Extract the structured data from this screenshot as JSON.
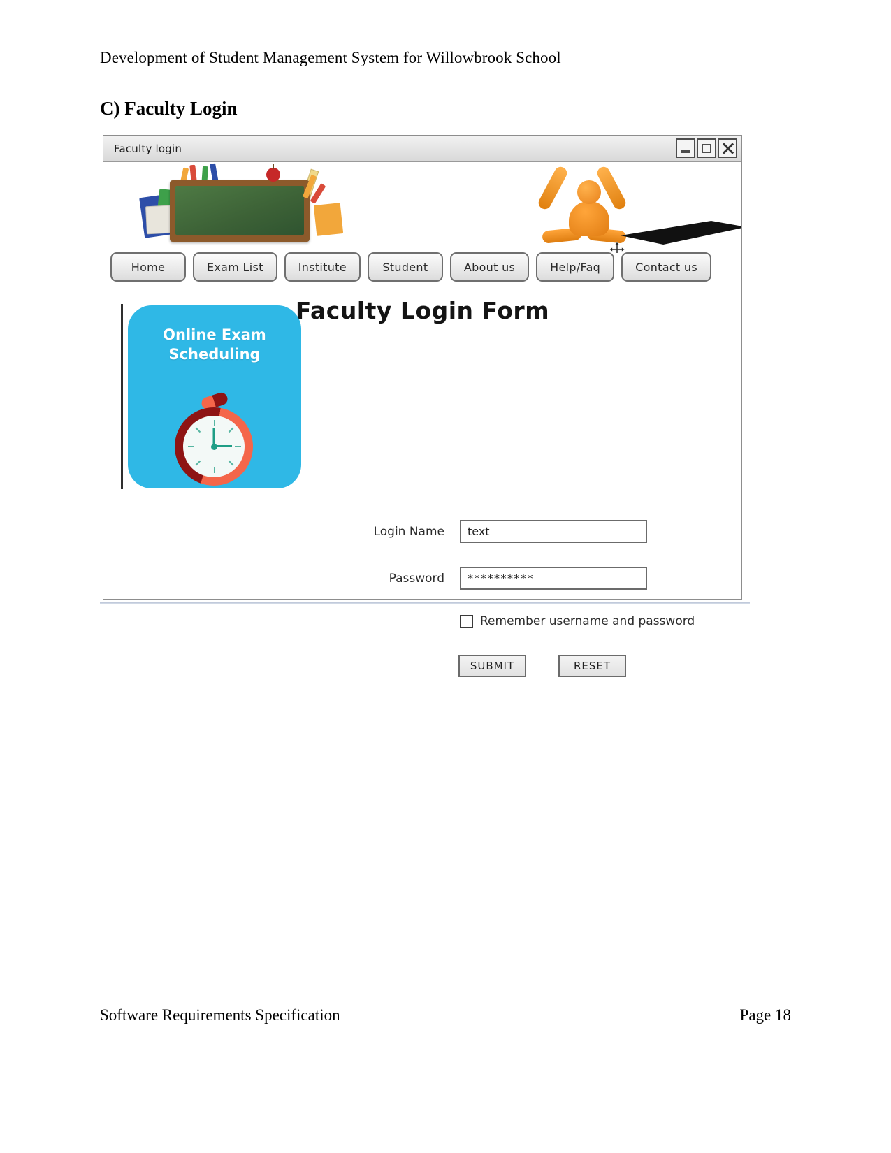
{
  "document": {
    "header": "Development of Student Management System for Willowbrook School",
    "section_title": "C) Faculty Login",
    "footer_left": "Software Requirements Specification",
    "footer_right": "Page 18"
  },
  "window": {
    "title": "Faculty login",
    "controls": {
      "minimize": "minimize-icon",
      "maximize": "maximize-icon",
      "close": "close-icon"
    }
  },
  "banner": {
    "left_graphic": "chalkboard-school-supplies-image",
    "right_graphic": "orange-3d-figure-image",
    "cursor": "move-cursor-icon"
  },
  "nav": {
    "tabs": [
      {
        "label": "Home"
      },
      {
        "label": "Exam List"
      },
      {
        "label": "Institute"
      },
      {
        "label": "Student"
      },
      {
        "label": "About us"
      },
      {
        "label": "Help/Faq"
      },
      {
        "label": "Contact us"
      }
    ]
  },
  "form": {
    "title": "Faculty Login Form",
    "promo": {
      "line1": "Online Exam",
      "line2": "Scheduling",
      "icon": "stopwatch-icon",
      "background_color": "#2fb8e6"
    },
    "fields": [
      {
        "label": "Login Name",
        "value": "text"
      },
      {
        "label": "Password",
        "value": "**********"
      }
    ],
    "checkbox": {
      "label": "Remember username and password",
      "checked": false
    },
    "buttons": [
      {
        "label": "SUBMIT"
      },
      {
        "label": "RESET"
      }
    ]
  }
}
